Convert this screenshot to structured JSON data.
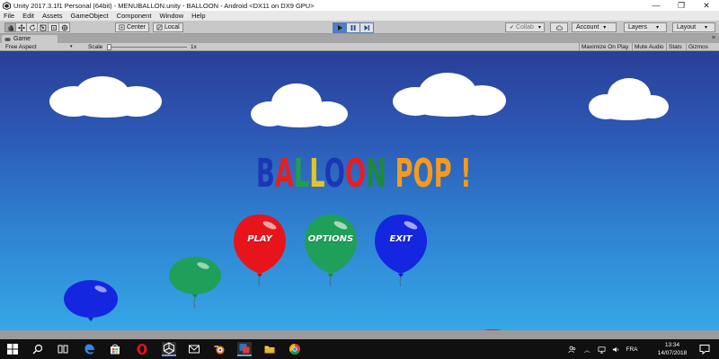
{
  "window": {
    "title": "Unity 2017.3.1f1 Personal (64bit) - MENUBALLON.unity - BALLOON - Android <DX11 on DX9 GPU>",
    "minimize_glyph": "—",
    "maximize_glyph": "❐",
    "close_glyph": "✕"
  },
  "menu": {
    "items": [
      "File",
      "Edit",
      "Assets",
      "GameObject",
      "Component",
      "Window",
      "Help"
    ]
  },
  "toolbar": {
    "pivot_center": "Center",
    "pivot_local": "Local",
    "collab": "Collab",
    "account": "Account",
    "layers": "Layers",
    "layout": "Layout",
    "caret": "▾"
  },
  "game_panel": {
    "tab_label": "Game",
    "panel_menu_glyph": "≡",
    "aspect": "Free Aspect",
    "scale_label": "Scale",
    "scale_value": "1x",
    "maximize_on_play": "Maximize On Play",
    "mute_audio": "Mute Audio",
    "stats": "Stats",
    "gizmos": "Gizmos"
  },
  "game": {
    "title_letters": [
      {
        "ch": "B",
        "color": "#1c37b5"
      },
      {
        "ch": "A",
        "color": "#e02026"
      },
      {
        "ch": "L",
        "color": "#21a04a"
      },
      {
        "ch": "L",
        "color": "#e6c426"
      },
      {
        "ch": "O",
        "color": "#1c37b5"
      },
      {
        "ch": "O",
        "color": "#e02026"
      },
      {
        "ch": "N",
        "color": "#1b8a3e"
      },
      {
        "ch": " ",
        "color": "#f49a1e"
      },
      {
        "ch": "P",
        "color": "#f49a1e"
      },
      {
        "ch": "O",
        "color": "#f49a1e"
      },
      {
        "ch": "P",
        "color": "#f49a1e"
      },
      {
        "ch": " ",
        "color": "#f49a1e"
      },
      {
        "ch": "!",
        "color": "#f49a1e"
      }
    ],
    "buttons": {
      "play": "PLAY",
      "options": "OPTIONS",
      "exit": "EXIT"
    },
    "colors": {
      "red": "#e8141c",
      "green": "#1fa05a",
      "blue": "#1426e0"
    }
  },
  "taskbar": {
    "icons": [
      "windows-start-icon",
      "search-icon",
      "task-view-icon",
      "edge-icon",
      "store-icon",
      "opera-icon",
      "unity-icon",
      "mail-icon",
      "blender-icon",
      "messenger-icon",
      "file-explorer-icon",
      "chrome-icon"
    ],
    "language": "FRA",
    "time": "13:34",
    "date": "14/07/2018"
  }
}
